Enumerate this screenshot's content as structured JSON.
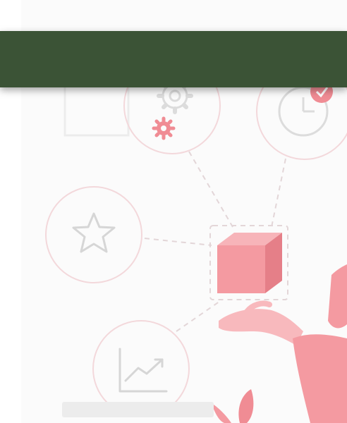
{
  "colors": {
    "banner": "#3b5336",
    "accent_pink": "#f08c94",
    "light_pink": "#f6cfd3",
    "line_gray": "#d9d9d9",
    "background": "#fbfbfb"
  },
  "illustration": {
    "icons": [
      "gear-icon",
      "clock-icon",
      "star-icon",
      "chart-icon",
      "box-icon",
      "hand-icon",
      "leaf-icon"
    ]
  }
}
